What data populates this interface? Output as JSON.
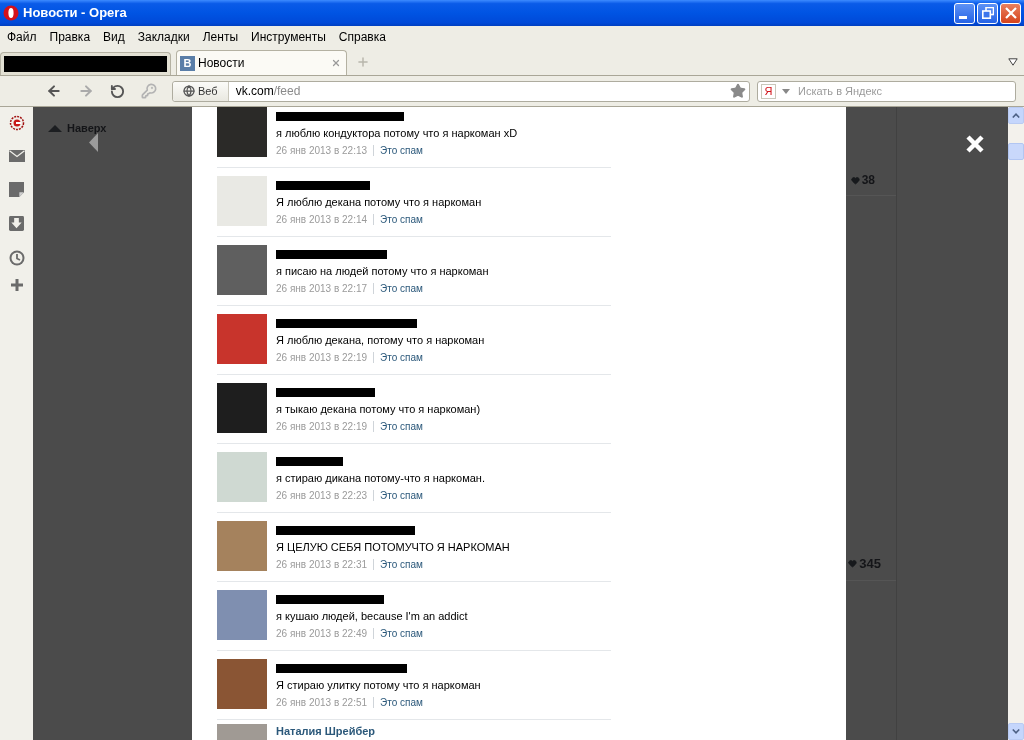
{
  "window": {
    "title": "Новости - Opera"
  },
  "menu": [
    "Файл",
    "Правка",
    "Вид",
    "Закладки",
    "Ленты",
    "Инструменты",
    "Справка"
  ],
  "tabs": [
    {
      "redacted": true,
      "selected": false
    },
    {
      "redacted": false,
      "favicon": "В",
      "label": "Новости",
      "selected": true
    }
  ],
  "address_bar": {
    "badge": "Веб",
    "host": "vk.com",
    "path": "/feed"
  },
  "search": {
    "engine": "Я",
    "placeholder": "Искать в Яндекс"
  },
  "page": {
    "back_to_top": "Наверх",
    "likes": [
      {
        "count": "38"
      },
      {
        "count": "345"
      }
    ]
  },
  "comments": [
    {
      "name_redacted": true,
      "text": "я люблю кондуктора потому что я наркоман xD",
      "date": "26 янв 2013 в 22:13",
      "spam_link": "Это спам"
    },
    {
      "name_redacted": true,
      "text": "Я люблю декана потому что я наркоман",
      "date": "26 янв 2013 в 22:14",
      "spam_link": "Это спам"
    },
    {
      "name_redacted": true,
      "text": "я писаю на людей потому что я наркоман",
      "date": "26 янв 2013 в 22:17",
      "spam_link": "Это спам"
    },
    {
      "name_redacted": true,
      "text": "Я люблю декана, потому что я наркоман",
      "date": "26 янв 2013 в 22:19",
      "spam_link": "Это спам"
    },
    {
      "name_redacted": true,
      "text": "я тыкаю декана потому что я наркоман)",
      "date": "26 янв 2013 в 22:19",
      "spam_link": "Это спам"
    },
    {
      "name_redacted": true,
      "text": "я стираю дикана потому-что я наркоман.",
      "date": "26 янв 2013 в 22:23",
      "spam_link": "Это спам"
    },
    {
      "name_redacted": true,
      "text": "Я ЦЕЛУЮ СЕБЯ ПОТОМУЧТО Я НАРКОМАН",
      "date": "26 янв 2013 в 22:31",
      "spam_link": "Это спам"
    },
    {
      "name_redacted": true,
      "text": "я кушаю людей, because I'm an addict",
      "date": "26 янв 2013 в 22:49",
      "spam_link": "Это спам"
    },
    {
      "name_redacted": true,
      "text": "Я стираю улитку потому что я наркоман",
      "date": "26 янв 2013 в 22:51",
      "spam_link": "Это спам"
    },
    {
      "name_redacted": false,
      "name": "Наталия Шрейбер"
    }
  ]
}
